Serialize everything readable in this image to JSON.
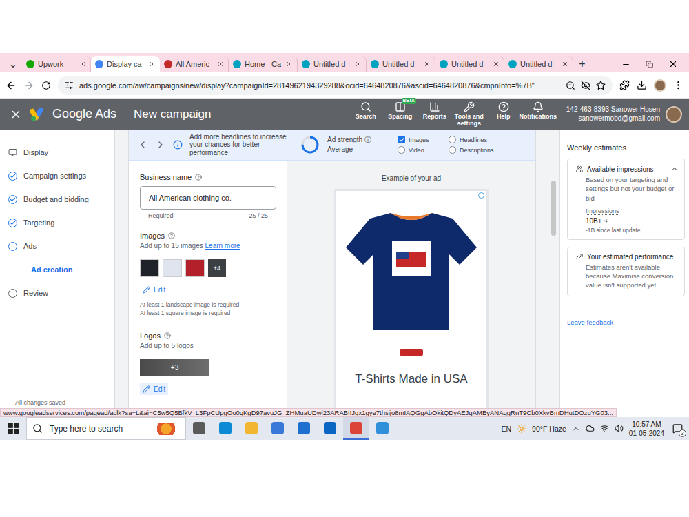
{
  "browser": {
    "tab_menu": "⌄",
    "tabs": [
      {
        "label": "Upwork - ",
        "selected": false,
        "color": "#14a800"
      },
      {
        "label": "Display ca",
        "selected": true,
        "color": "#4285f4"
      },
      {
        "label": "All Americ",
        "selected": false,
        "color": "#c62828"
      },
      {
        "label": "Home - Ca",
        "selected": false,
        "color": "#00a3bf"
      },
      {
        "label": "Untitled d",
        "selected": false,
        "color": "#00a3bf"
      },
      {
        "label": "Untitled d",
        "selected": false,
        "color": "#00a3bf"
      },
      {
        "label": "Untitled d",
        "selected": false,
        "color": "#00a3bf"
      },
      {
        "label": "Untitled d",
        "selected": false,
        "color": "#00a3bf"
      }
    ],
    "new_tab": "+",
    "url": "ads.google.com/aw/campaigns/new/display?campaignId=2814962194329288&ocid=6464820876&ascid=6464820876&cmpnInfo=%7B\""
  },
  "header": {
    "product": "Google Ads",
    "title": "New campaign",
    "tools": [
      {
        "label": "Search"
      },
      {
        "label": "Spacing",
        "badge": "BETA"
      },
      {
        "label": "Reports"
      },
      {
        "label": "Tools and settings"
      },
      {
        "label": "Help"
      },
      {
        "label": "Notifications"
      }
    ],
    "account": {
      "line": "142-463-8393 Sanower Hosen",
      "email": "sanowermobd@gmail.com"
    }
  },
  "steps": [
    {
      "label": "Display",
      "kind": "title",
      "done": false,
      "current": false,
      "selected": false
    },
    {
      "label": "Campaign settings",
      "kind": "step",
      "done": true,
      "current": false,
      "selected": false
    },
    {
      "label": "Budget and bidding",
      "kind": "step",
      "done": true,
      "current": false,
      "selected": false
    },
    {
      "label": "Targeting",
      "kind": "step",
      "done": true,
      "current": false,
      "selected": false
    },
    {
      "label": "Ads",
      "kind": "step",
      "done": false,
      "current": true,
      "selected": false
    },
    {
      "label": "Ad creation",
      "kind": "sub",
      "done": false,
      "current": false,
      "selected": true
    },
    {
      "label": "Review",
      "kind": "step",
      "done": false,
      "current": false,
      "selected": false
    }
  ],
  "strength": {
    "tip": "Add more headlines to increase your chances for better performance",
    "title": "Ad strength",
    "rating": "Average",
    "level": 0.75,
    "assets": [
      {
        "label": "Images",
        "checked": true
      },
      {
        "label": "Headlines",
        "checked": false
      },
      {
        "label": "Video",
        "checked": false
      },
      {
        "label": "Descriptions",
        "checked": false
      }
    ]
  },
  "form": {
    "business": {
      "label": "Business name",
      "value": "All American clothing co.",
      "hint": "Required",
      "count": "25 / 25"
    },
    "images": {
      "label": "Images",
      "hint": "Add up to 15 images",
      "link": "Learn more",
      "thumbnails": [
        {
          "color": "#1f2228"
        },
        {
          "color": "#dfe4ee"
        },
        {
          "color": "#b3202a"
        }
      ],
      "more": "+4",
      "edit": "Edit",
      "notes": [
        "At least 1 landscape image is required",
        "At least 1 square image is required"
      ]
    },
    "logos": {
      "label": "Logos",
      "hint": "Add up to 5 logos",
      "more": "+3",
      "edit": "Edit"
    },
    "saved": "All changes saved"
  },
  "preview": {
    "caption": "Example of your ad",
    "headline": "T-Shirts Made in USA"
  },
  "estimates": {
    "title": "Weekly estimates",
    "impressions": {
      "title": "Available impressions",
      "expanded": true,
      "note": "Based on your targeting and settings but not your budget or bid",
      "label": "Impressions",
      "value": "10B+",
      "change": "-1B since last update"
    },
    "performance": {
      "title": "Your estimated performance",
      "note": "Estimates aren't available because Maximise conversion value isn't supported yet"
    },
    "feedback": "Leave feedback"
  },
  "status_url": "www.googleadservices.com/pagead/aclk?sa=L&ai=C5w5Q5BfkV_L3FpCUpgOo0qKgD97avuJG_ZHMuaUDwl23ARABIIJgx1gye7thsijo8mIAQGgAbOkitQDyAEJqAMByANAqgRnT9Cb0XkvBmDHutDOzuYG03...",
  "taskbar": {
    "search": "Type here to search",
    "apps": [
      {
        "color": "#5a5a5a",
        "selected": false
      },
      {
        "color": "#0c8ad6",
        "selected": false
      },
      {
        "color": "#f2b632",
        "selected": false
      },
      {
        "color": "#3a78d8",
        "selected": false
      },
      {
        "color": "#1f6fd1",
        "selected": false
      },
      {
        "color": "#0a64c2",
        "selected": false
      },
      {
        "color": "#db4437",
        "selected": true
      },
      {
        "color": "#2f8fd8",
        "selected": false
      }
    ],
    "lang": "EN",
    "weather": "90°F Haze",
    "time": "10:57 AM",
    "date": "01-05-2024",
    "notifications": "3"
  }
}
